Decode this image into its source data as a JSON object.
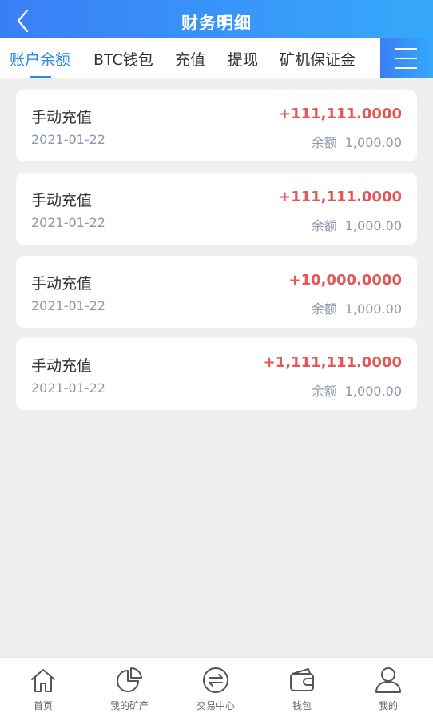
{
  "header": {
    "title": "财务明细"
  },
  "tabs": [
    {
      "label": "账户余额",
      "active": true
    },
    {
      "label": "BTC钱包"
    },
    {
      "label": "充值"
    },
    {
      "label": "提现"
    },
    {
      "label": "矿机保证金"
    }
  ],
  "records": [
    {
      "title": "手动充值",
      "date": "2021-01-22",
      "amount": "+111,111.0000",
      "balance_label": "余额",
      "balance": "1,000.00"
    },
    {
      "title": "手动充值",
      "date": "2021-01-22",
      "amount": "+111,111.0000",
      "balance_label": "余额",
      "balance": "1,000.00"
    },
    {
      "title": "手动充值",
      "date": "2021-01-22",
      "amount": "+10,000.0000",
      "balance_label": "余额",
      "balance": "1,000.00"
    },
    {
      "title": "手动充值",
      "date": "2021-01-22",
      "amount": "+1,111,111.0000",
      "balance_label": "余额",
      "balance": "1,000.00"
    }
  ],
  "bottom_nav": [
    {
      "label": "首页",
      "icon": "home-icon"
    },
    {
      "label": "我的矿产",
      "icon": "pie-chart-icon"
    },
    {
      "label": "交易中心",
      "icon": "exchange-icon"
    },
    {
      "label": "钱包",
      "icon": "wallet-icon"
    },
    {
      "label": "我的",
      "icon": "user-icon"
    }
  ],
  "colors": {
    "header_gradient_start": "#3a7ef6",
    "header_gradient_end": "#36a9fb",
    "active_tab": "#2a89e6",
    "amount": "#e25757",
    "muted_text": "#8d97ad",
    "background": "#efefed"
  }
}
